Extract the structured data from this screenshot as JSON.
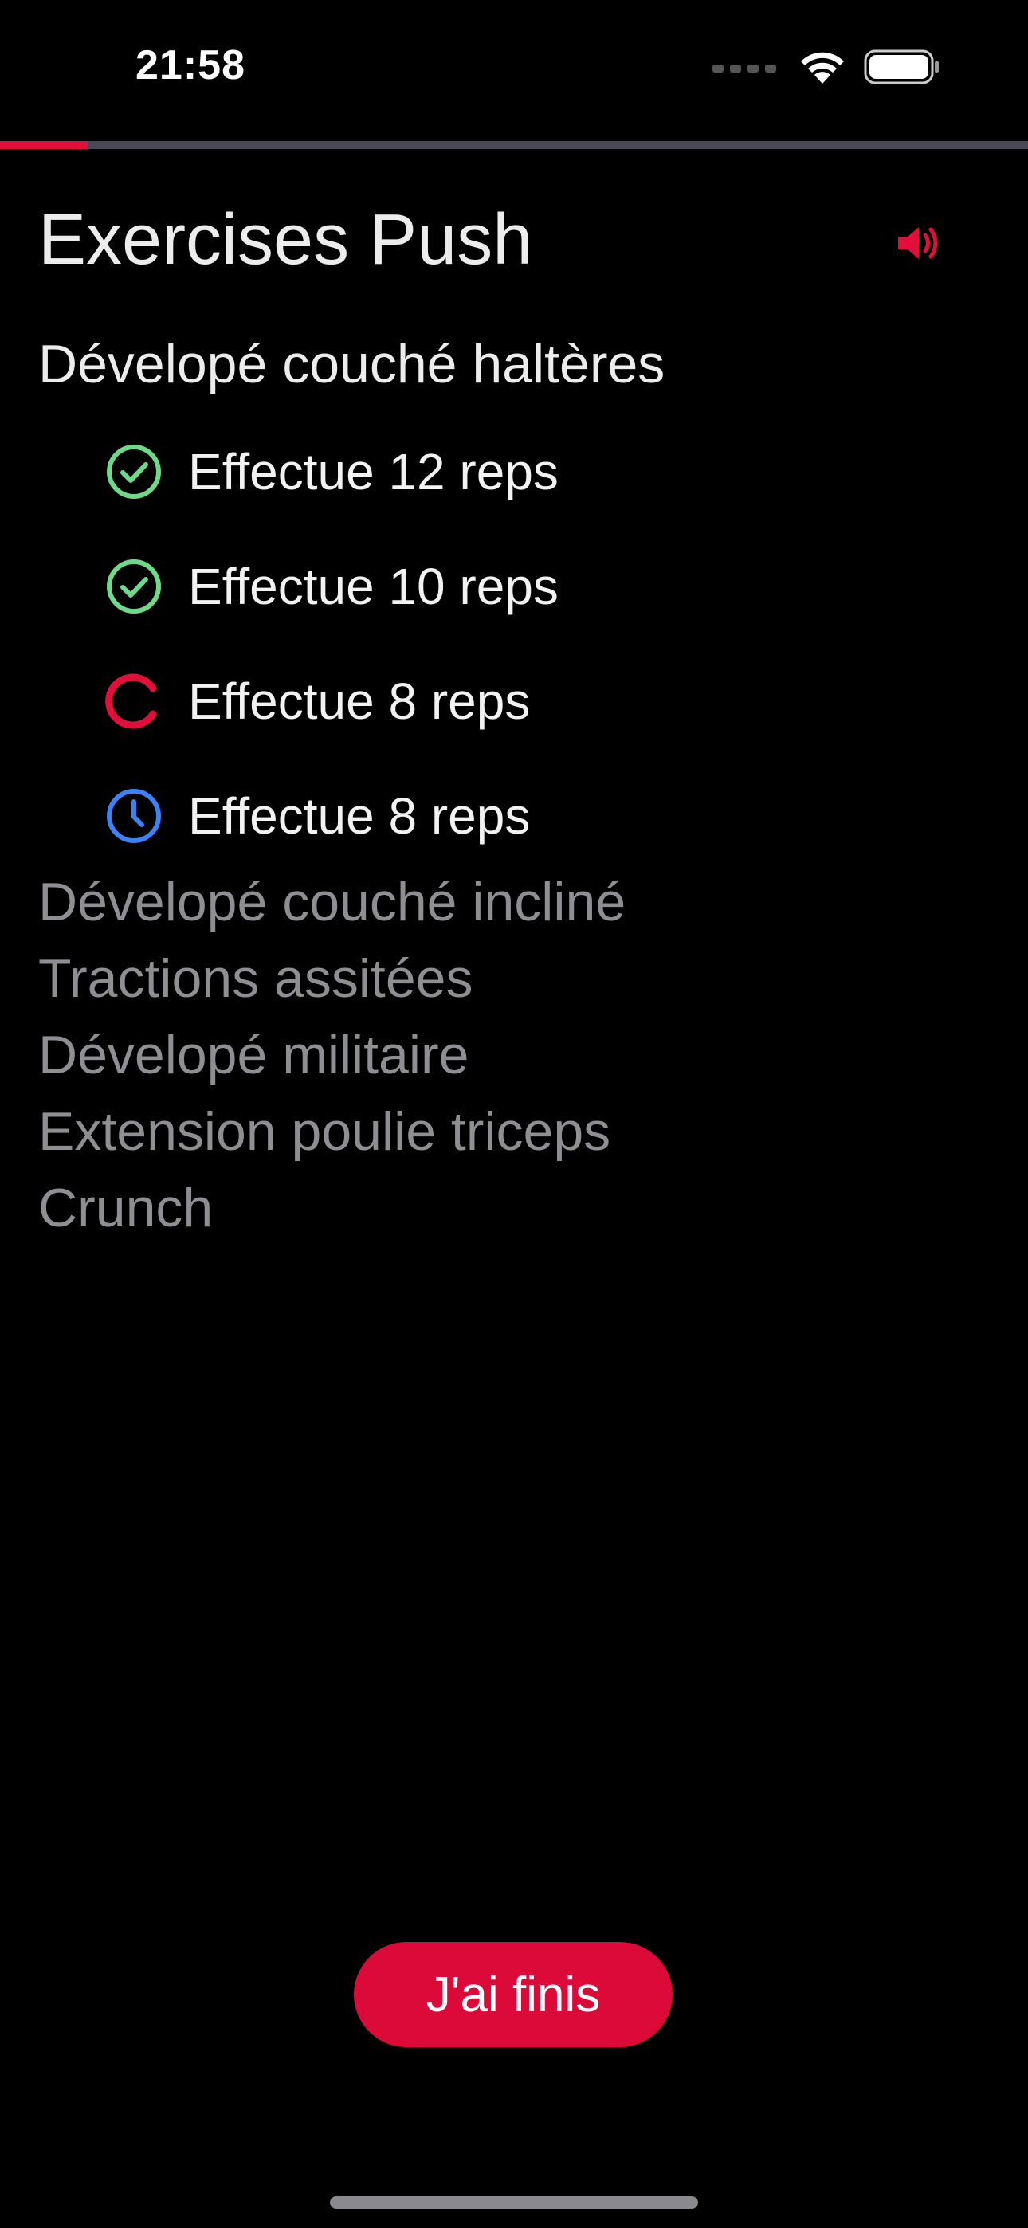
{
  "status_bar": {
    "time": "21:58"
  },
  "progress": {
    "fraction": 0.085,
    "fill_color": "#E0103A",
    "track_color": "#4A4857"
  },
  "header": {
    "title": "Exercises Push",
    "sound_icon": "speaker-volume-icon"
  },
  "current_exercise": {
    "name": "Dévelopé couché haltères",
    "sets": [
      {
        "label": "Effectue 12 reps",
        "status": "done",
        "icon": "check-circle-icon",
        "color": "#6FD98A"
      },
      {
        "label": "Effectue 10 reps",
        "status": "done",
        "icon": "check-circle-icon",
        "color": "#6FD98A"
      },
      {
        "label": "Effectue 8 reps",
        "status": "in-progress",
        "icon": "spinner-icon",
        "color": "#E0103A"
      },
      {
        "label": "Effectue 8 reps",
        "status": "pending",
        "icon": "clock-icon",
        "color": "#3B82F6"
      }
    ]
  },
  "upcoming_exercises": [
    "Dévelopé couché incliné",
    "Tractions assitées",
    "Dévelopé militaire",
    "Extension poulie triceps",
    "Crunch"
  ],
  "finish_button": {
    "label": "J'ai finis",
    "color": "#DC0A38"
  }
}
